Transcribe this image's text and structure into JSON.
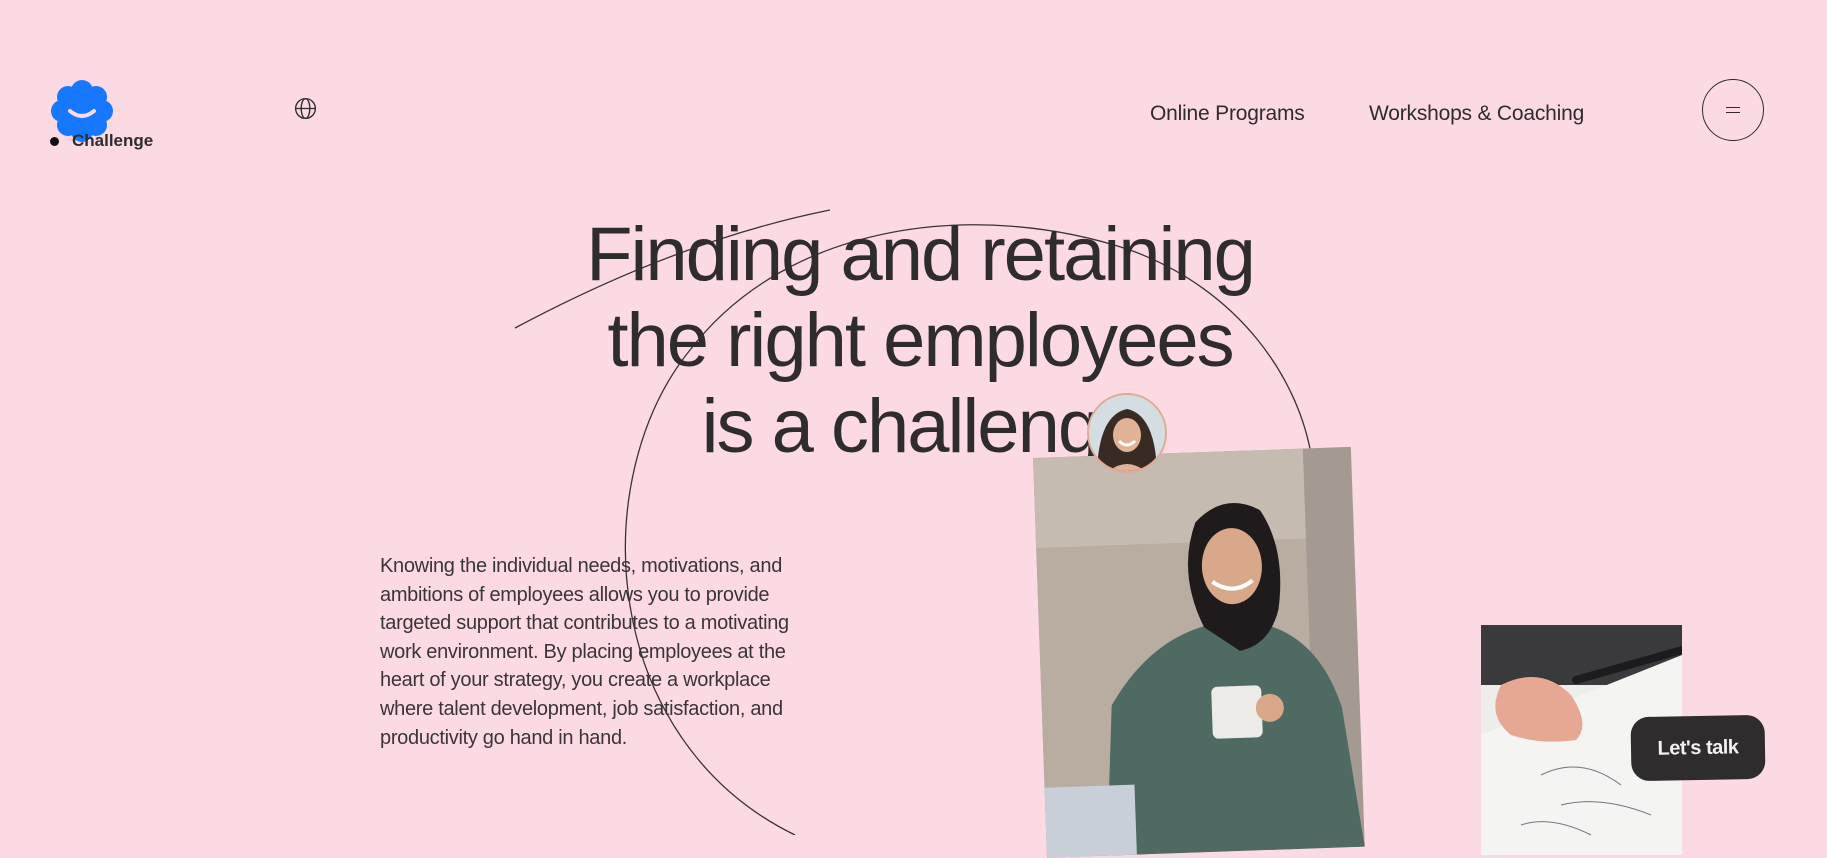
{
  "header": {
    "logo_icon": "smiley-flower-logo",
    "brand_color": "#1677ff",
    "section_label": "Challenge",
    "language_icon": "globe-icon",
    "nav": [
      {
        "label": "Online Programs"
      },
      {
        "label": "Workshops & Coaching"
      }
    ],
    "menu_icon": "hamburger-icon"
  },
  "hero": {
    "headline_lines": [
      "Finding and retaining",
      "the right employees",
      "is a challenge"
    ],
    "body": "Knowing the individual needs, motivations, and ambitions of employees allows you to provide targeted support that contributes to a motivating work environment. By placing employees at the heart of your strategy, you create a workplace where talent development, job satisfaction, and productivity go hand in hand."
  },
  "cta": {
    "label": "Let's talk"
  },
  "colors": {
    "background": "#fbdae4",
    "text": "#2f2c2e",
    "button": "#2f2c2e"
  }
}
